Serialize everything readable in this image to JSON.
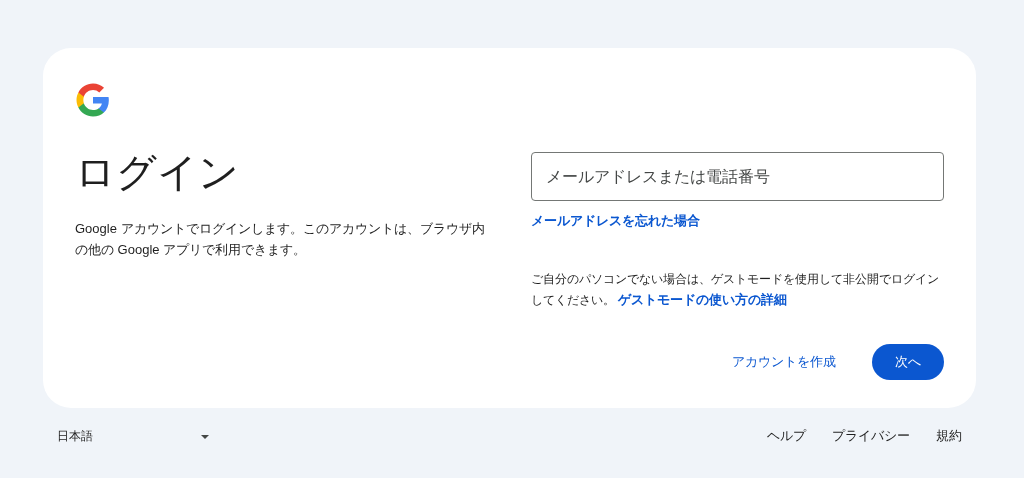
{
  "card": {
    "heading": "ログイン",
    "description": "Google アカウントでログインします。このアカウントは、ブラウザ内の他の Google アプリで利用できます。",
    "email_field": {
      "placeholder": "メールアドレスまたは電話番号"
    },
    "forgot_link": "メールアドレスを忘れた場合",
    "guest_notice": {
      "text": "ご自分のパソコンでない場合は、ゲストモードを使用して非公開でログインしてください。",
      "link": "ゲストモードの使い方の詳細"
    },
    "create_account": "アカウントを作成",
    "next_button": "次へ"
  },
  "footer": {
    "language": "日本語",
    "links": [
      "ヘルプ",
      "プライバシー",
      "規約"
    ]
  }
}
